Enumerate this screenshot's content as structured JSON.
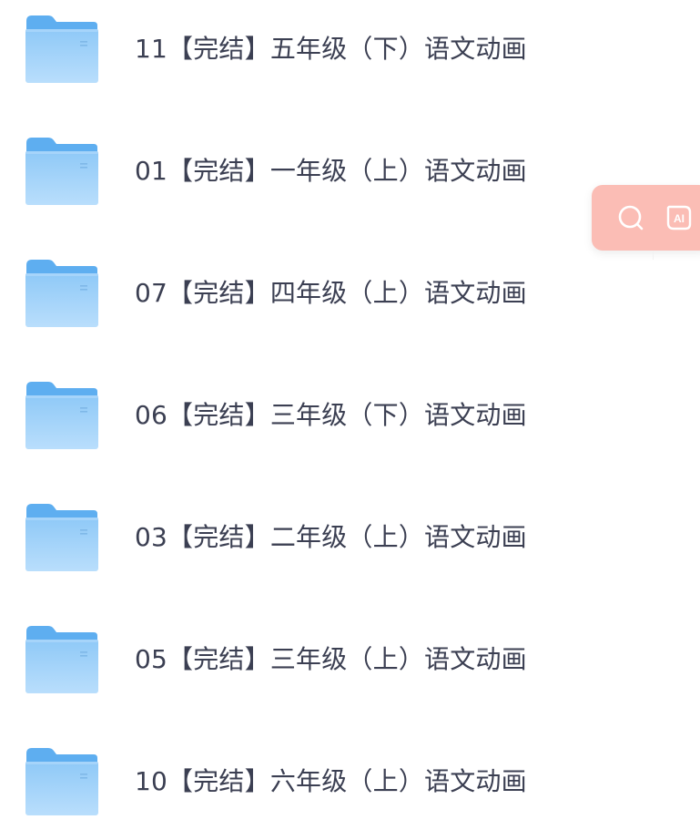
{
  "files": [
    {
      "name": "11【完结】五年级（下）语文动画",
      "icon": "folder-icon"
    },
    {
      "name": "01【完结】一年级（上）语文动画",
      "icon": "folder-icon"
    },
    {
      "name": "07【完结】四年级（上）语文动画",
      "icon": "folder-icon"
    },
    {
      "name": "06【完结】三年级（下）语文动画",
      "icon": "folder-icon"
    },
    {
      "name": "03【完结】二年级（上）语文动画",
      "icon": "folder-icon"
    },
    {
      "name": "05【完结】三年级（上）语文动画",
      "icon": "folder-icon"
    },
    {
      "name": "10【完结】六年级（上）语文动画",
      "icon": "folder-icon"
    }
  ],
  "floating_toolbar": {
    "search_icon": "search-icon",
    "ai_icon": "ai-icon",
    "ai_label": "AI",
    "background_color": "#fbbdb5"
  },
  "colors": {
    "folder_back": "#5eaef0",
    "folder_front_top": "#8cc8f8",
    "folder_front_bottom": "#b6dcfc",
    "text": "#3b3f52"
  }
}
